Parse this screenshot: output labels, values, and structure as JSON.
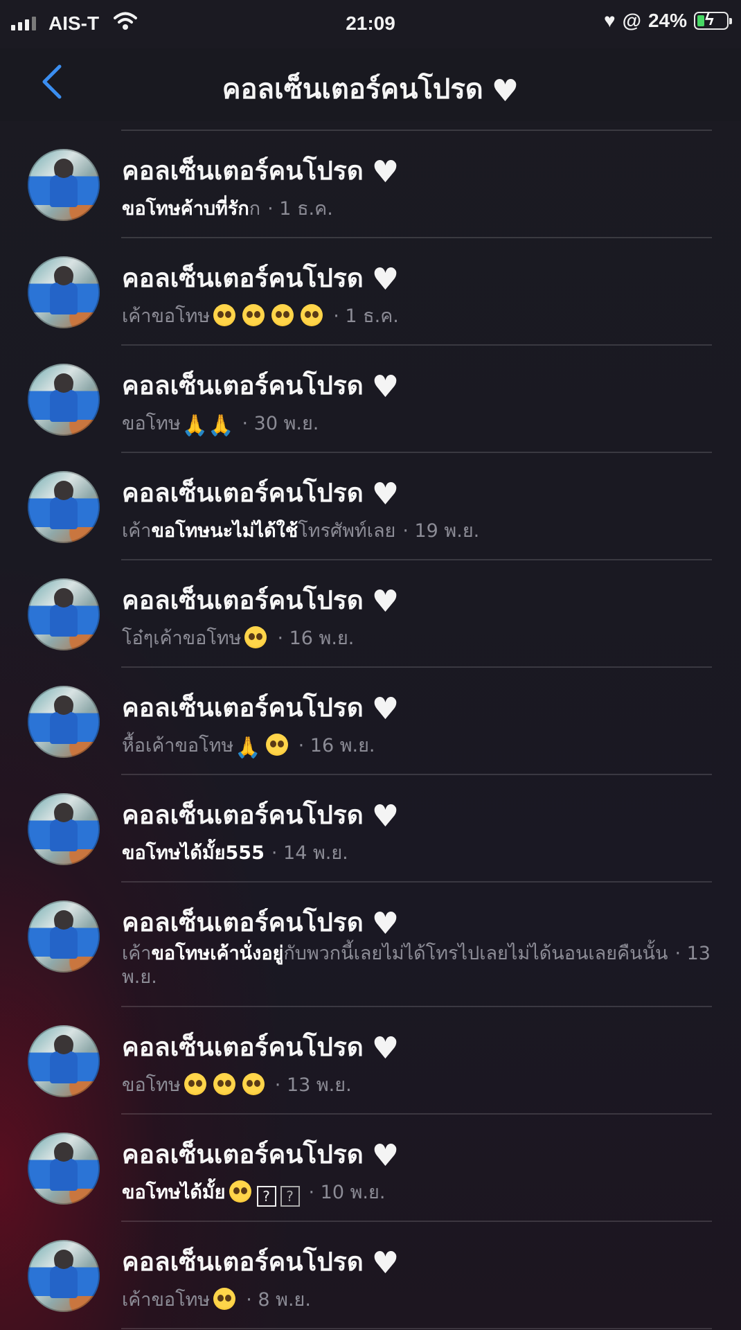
{
  "status_bar": {
    "carrier": "AIS-T",
    "time": "21:09",
    "battery": "24%"
  },
  "nav": {
    "title": "คอลเซ็นเตอร์คนโปรด",
    "title_emoji": "🤍"
  },
  "conversation_name": "คอลเซ็นเตอร์คนโปรด",
  "heart": "🤍",
  "messages": [
    {
      "preview_bold": "ขอโทษค้าบที่รัก",
      "preview": "ก",
      "date": "· 1 ธ.ค."
    },
    {
      "preview": "เค้าขอโทษ",
      "emojis": 4,
      "date": "· 1 ธ.ค."
    },
    {
      "preview": "ขอโทษ",
      "pray": "🙏🙏",
      "date": "· 30 พ.ย."
    },
    {
      "preview_pre": "เค้า",
      "preview_bold": "ขอโทษนะไม่ได้ใช้",
      "preview_post": "โทรศัพท์เลย",
      "date": "· 19 พ.ย."
    },
    {
      "preview": "โอ๋ๆเค้าขอโทษ",
      "emojis": 1,
      "date": "· 16 พ.ย."
    },
    {
      "preview": "หื้อเค้าขอโทษ",
      "pray": "🙏",
      "emojis": 1,
      "date": "· 16 พ.ย."
    },
    {
      "preview_bold": "ขอโทษได้มั้ย555",
      "date": "· 14 พ.ย."
    },
    {
      "preview_pre": "เค้า",
      "preview_bold": "ขอโทษเค้านั่งอยู่",
      "preview_post": "กับพวกนี้เลยไม่ได้โทรไปเลยไม่ได้นอนเลยคืนนั้น",
      "date": "· 13 พ.ย."
    },
    {
      "preview": "ขอโทษ",
      "emojis": 3,
      "date": "· 13 พ.ย."
    },
    {
      "preview_bold": "ขอโทษได้มั้ย",
      "emojis": 1,
      "qmark": "?",
      "date": "· 10 พ.ย."
    },
    {
      "preview": "เค้าขอโทษ",
      "emojis": 1,
      "date": "· 8 พ.ย."
    }
  ]
}
